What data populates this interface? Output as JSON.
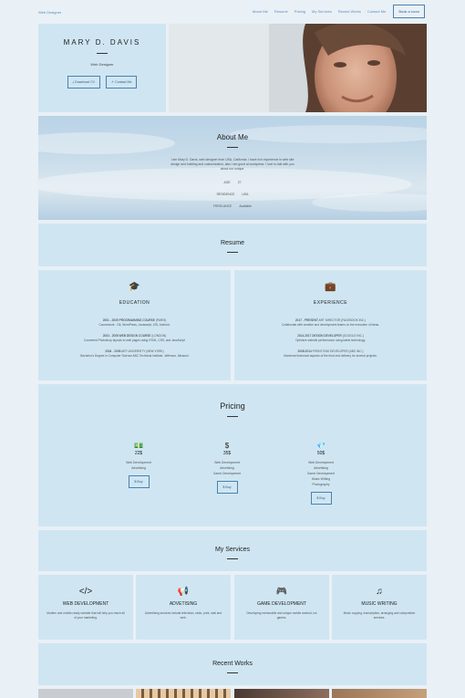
{
  "nav": {
    "brand": "Web Designer",
    "links": [
      "About Me",
      "Resume",
      "Pricing",
      "My Services",
      "Recent Works",
      "Contact Me"
    ],
    "cta": "Book a room"
  },
  "hero": {
    "name": "MARY D. DAVIS",
    "role": "Web Designer",
    "buttons": [
      {
        "label": "Download CV",
        "icon": "download-icon"
      },
      {
        "label": "Contact Me",
        "icon": "send-icon"
      }
    ]
  },
  "about": {
    "title": "About Me",
    "text": "I am Mary D. Davis, web designer from USA, California. I have rich experience in web site design and building and customization, also I am good at wordpress. I love to talk with you about our unique.",
    "facts": [
      {
        "label": "AGE",
        "value": "27"
      },
      {
        "label": "RESIDENCE",
        "value": "USA"
      },
      {
        "label": "FREELANCE",
        "value": "Available"
      }
    ]
  },
  "resume": {
    "title": "Resume",
    "education": {
      "title": "EDUCATION",
      "icon": "graduation-cap-icon",
      "entries": [
        {
          "head": "2001 - 2009 PROGRAMMING COURSE",
          "place": "(PARIS)",
          "desc": "Coursework - Git, WordPress, Javascript, iOS, Android."
        },
        {
          "head": "2003 - 2005 WEB DESIGN COURSE",
          "place": "(LONDON)",
          "desc": "Converted Photoshop layouts to web pages using HTML, CSS, and JavaScript"
        },
        {
          "head": "2004 - 2005",
          "place": "ART UNIVERSITY (NEW YORK)",
          "desc": "Bachelor's Degree in Computer Science ABC Technical Institute, Jefferson, Missouri"
        }
      ]
    },
    "experience": {
      "title": "EXPERIENCE",
      "icon": "briefcase-icon",
      "entries": [
        {
          "head": "2017 - PRESENT",
          "place": "ART DIRECTOR (FACEBOOK INC.)",
          "desc": "Collaborate with creative and development teams on the execution of ideas."
        },
        {
          "head": "2014-2017 DESIGN DEVELOPER",
          "place": "(GOOGLE INC.)",
          "desc": "Optimize website performance using latest technology."
        },
        {
          "head": "2008-2014",
          "place": "FRONT-END DEVELOPER (ABC INC.)",
          "desc": "Monitored technical aspects of the front-end delivery for several projects."
        }
      ]
    }
  },
  "pricing": {
    "title": "Pricing",
    "plans": [
      {
        "icon": "money-icon",
        "price": "22$",
        "features": [
          "Web Development",
          "Advetising"
        ],
        "buy": "Buy"
      },
      {
        "icon": "dollar-icon",
        "price": "35$",
        "features": [
          "Web Development",
          "Advetising",
          "Game Development"
        ],
        "buy": "Buy"
      },
      {
        "icon": "diamond-icon",
        "price": "50$",
        "features": [
          "Web Development",
          "Advetising",
          "Game Development",
          "Music Writing",
          "Photography"
        ],
        "buy": "Buy"
      }
    ]
  },
  "services": {
    "title": "My Services",
    "items": [
      {
        "icon": "code-icon",
        "title": "WEB DEVELOPMENT",
        "desc": "Modern and mobile-ready website that will help you reach all of your marketing."
      },
      {
        "icon": "megaphone-icon",
        "title": "ADVETISING",
        "desc": "Advertising services include television, radio, print, mail and web."
      },
      {
        "icon": "gamepad-icon",
        "title": "GAME DEVELOPMENT",
        "desc": "Developing memorable and unique mobile android, ios games."
      },
      {
        "icon": "music-icon",
        "title": "MUSIC WRITING",
        "desc": "Music copying, transcription, arranging and composition services."
      }
    ]
  },
  "works": {
    "title": "Recent Works"
  }
}
